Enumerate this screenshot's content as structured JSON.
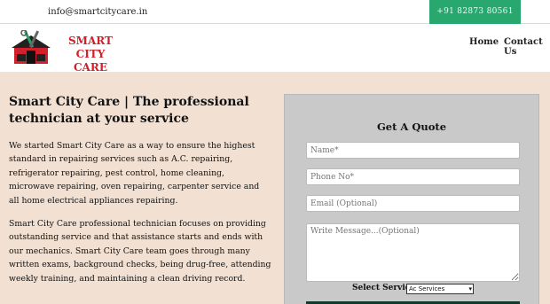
{
  "topbar": {
    "email": "info@smartcitycare.in",
    "phone": "+91 82873 80561"
  },
  "header": {
    "brand_line1": "SMART CITY",
    "brand_line2": "CARE",
    "nav": [
      "Home",
      "Contact Us"
    ]
  },
  "intro": {
    "heading": "Smart City Care | The professional technician at your service",
    "para1": "We started Smart City Care as a way to ensure the highest standard in repairing services such as A.C. repairing, refrigerator repairing, pest control, home cleaning, microwave repairing, oven repairing, carpenter service and all home electrical appliances repairing.",
    "para2": "Smart City Care professional technician focuses on providing outstanding service and that assistance starts and ends with our mechanics. Smart City Care team goes through many written exams, background checks, being drug-free, attending weekly training, and maintaining a clean driving record."
  },
  "quote_form": {
    "title": "Get A Quote",
    "name_placeholder": "Name*",
    "phone_placeholder": "Phone No*",
    "email_placeholder": "Email (Optional)",
    "message_placeholder": "Write Message...(Optional)",
    "services_label": "Select Services:",
    "services_selected": "Ac Services"
  },
  "colors": {
    "accent_green": "#28a86f",
    "brand_red": "#d11f2b",
    "panel_bg": "#f2e0d2"
  }
}
